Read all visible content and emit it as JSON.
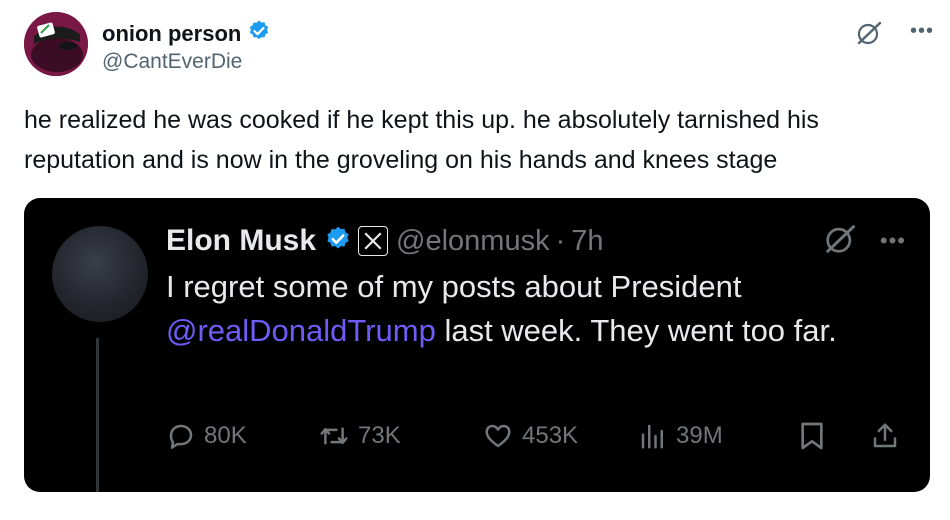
{
  "outer_post": {
    "display_name": "onion person",
    "handle": "@CantEverDie",
    "text": "he realized he was cooked if he kept this up.  he absolutely tarnished his reputation and is now in the groveling on his hands and knees stage",
    "icons": [
      "avatar",
      "verified-badge-icon",
      "grok-icon",
      "more-icon"
    ]
  },
  "quoted_post": {
    "display_name": "Elon Musk",
    "handle": "@elonmusk",
    "separator": "·",
    "time": "7h",
    "text_before": "I regret some of my posts about President",
    "mention": "@realDonaldTrump",
    "text_after": "last week. They went too far.",
    "colors": {
      "background": "#000000",
      "mention": "#6d5cf5",
      "verified": "#1d9bf0"
    },
    "actions": {
      "replies": "80K",
      "reposts": "73K",
      "likes": "453K",
      "views": "39M"
    }
  }
}
